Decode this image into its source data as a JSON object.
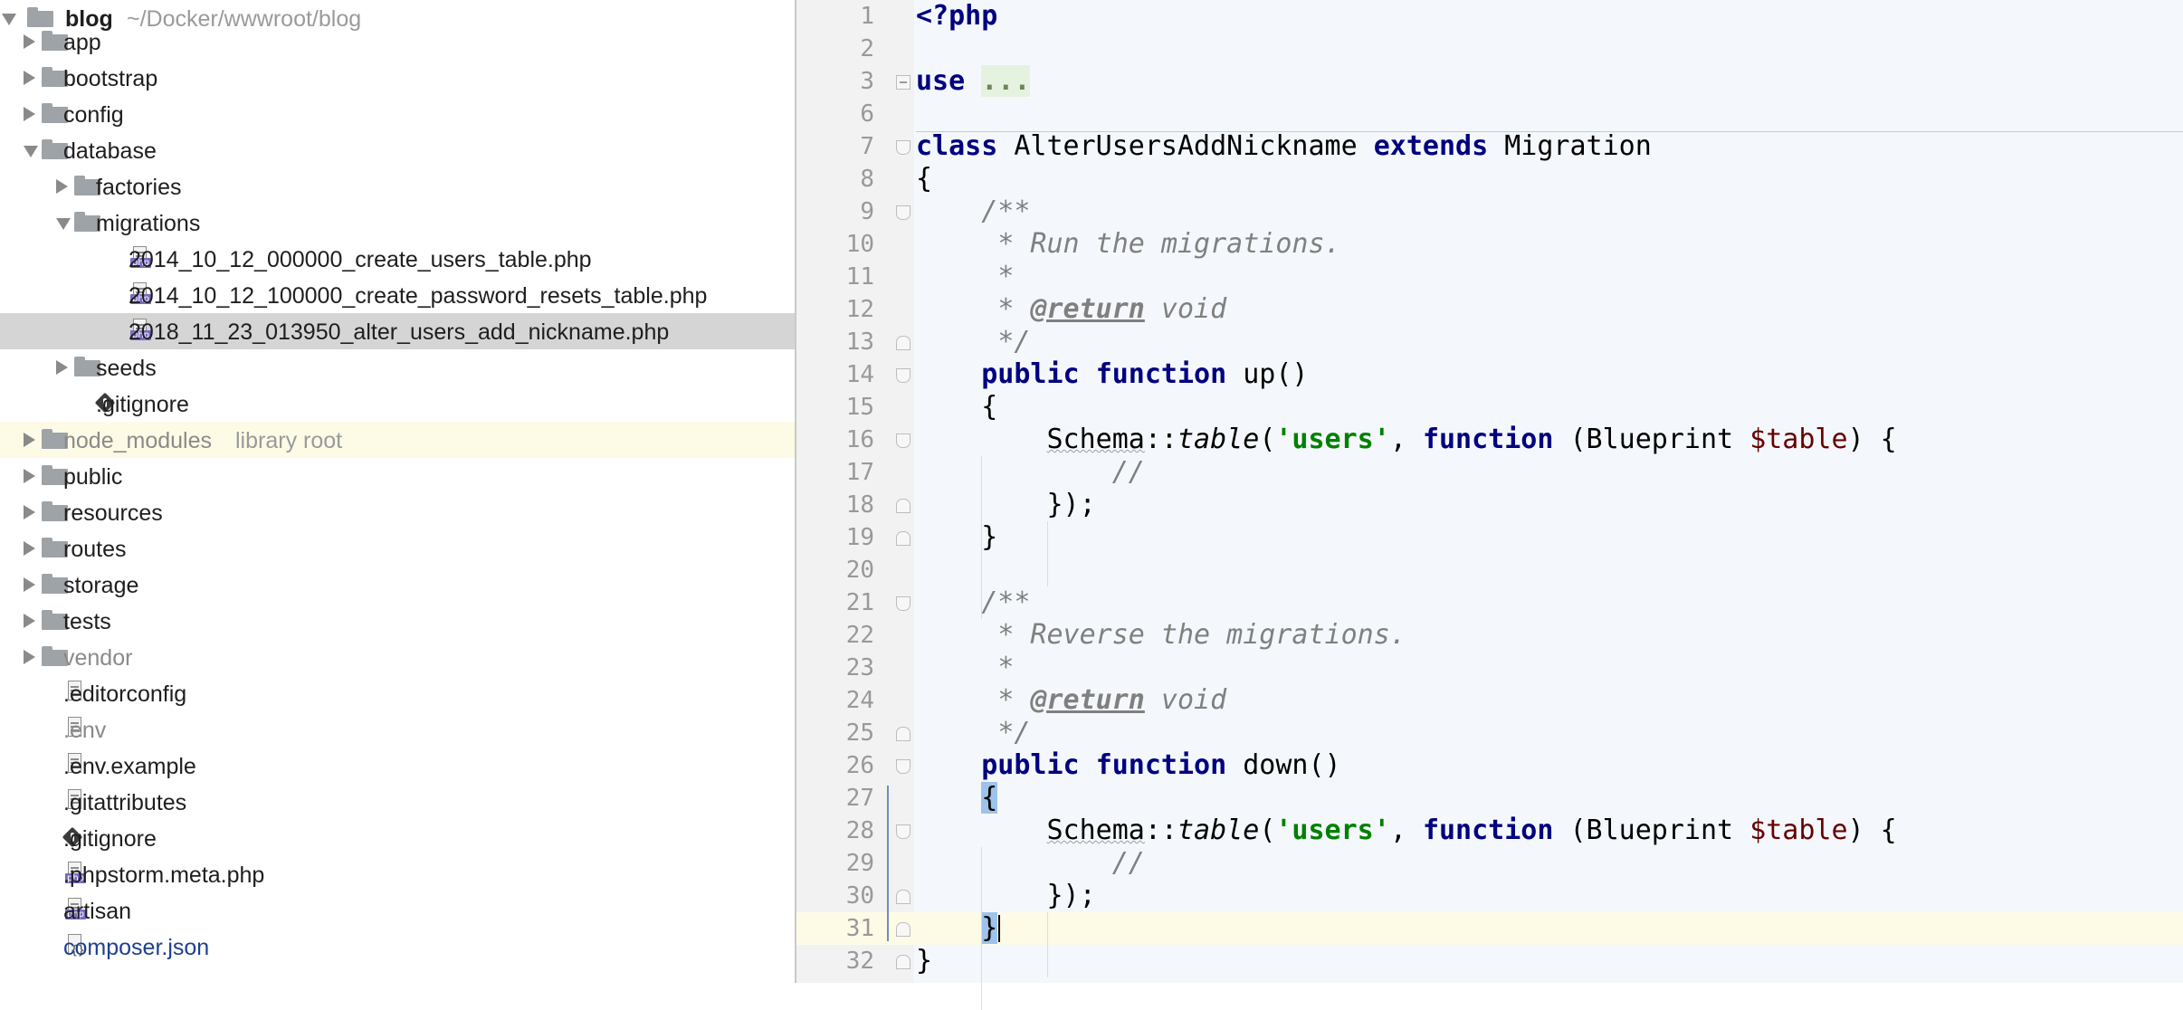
{
  "project_tree": {
    "root": {
      "name": "blog",
      "path": "~/Docker/wwwroot/blog"
    },
    "items": [
      {
        "label": "app",
        "kind": "folder",
        "depth": 1,
        "state": "collapsed"
      },
      {
        "label": "bootstrap",
        "kind": "folder",
        "depth": 1,
        "state": "collapsed"
      },
      {
        "label": "config",
        "kind": "folder",
        "depth": 1,
        "state": "collapsed"
      },
      {
        "label": "database",
        "kind": "folder",
        "depth": 1,
        "state": "expanded"
      },
      {
        "label": "factories",
        "kind": "folder",
        "depth": 2,
        "state": "collapsed"
      },
      {
        "label": "migrations",
        "kind": "folder",
        "depth": 2,
        "state": "expanded"
      },
      {
        "label": "2014_10_12_000000_create_users_table.php",
        "kind": "php",
        "depth": 3
      },
      {
        "label": "2014_10_12_100000_create_password_resets_table.php",
        "kind": "php",
        "depth": 3
      },
      {
        "label": "2018_11_23_013950_alter_users_add_nickname.php",
        "kind": "php",
        "depth": 3,
        "selected": true
      },
      {
        "label": "seeds",
        "kind": "folder",
        "depth": 2,
        "state": "collapsed"
      },
      {
        "label": ".gitignore",
        "kind": "git",
        "depth": 2
      },
      {
        "label": "node_modules",
        "kind": "folder",
        "depth": 1,
        "state": "collapsed",
        "excluded": true,
        "hint": "library root"
      },
      {
        "label": "public",
        "kind": "folder",
        "depth": 1,
        "state": "collapsed"
      },
      {
        "label": "resources",
        "kind": "folder",
        "depth": 1,
        "state": "collapsed"
      },
      {
        "label": "routes",
        "kind": "folder",
        "depth": 1,
        "state": "collapsed"
      },
      {
        "label": "storage",
        "kind": "folder",
        "depth": 1,
        "state": "collapsed"
      },
      {
        "label": "tests",
        "kind": "folder",
        "depth": 1,
        "state": "collapsed"
      },
      {
        "label": "vendor",
        "kind": "folder",
        "depth": 1,
        "state": "collapsed",
        "dim": true
      },
      {
        "label": ".editorconfig",
        "kind": "text",
        "depth": 1
      },
      {
        "label": ".env",
        "kind": "text",
        "depth": 1,
        "dim": true
      },
      {
        "label": ".env.example",
        "kind": "text",
        "depth": 1
      },
      {
        "label": ".gitattributes",
        "kind": "text",
        "depth": 1
      },
      {
        "label": ".gitignore",
        "kind": "git",
        "depth": 1
      },
      {
        "label": ".phpstorm.meta.php",
        "kind": "php",
        "depth": 1
      },
      {
        "label": "artisan",
        "kind": "php",
        "depth": 1
      },
      {
        "label": "composer.json",
        "kind": "json",
        "depth": 1,
        "link": true
      }
    ]
  },
  "editor": {
    "current_line": "31",
    "lines": [
      {
        "n": "1",
        "tokens": [
          {
            "t": "<?php",
            "c": "kw"
          }
        ]
      },
      {
        "n": "2",
        "tokens": []
      },
      {
        "n": "3",
        "fold": "collapsed",
        "tokens": [
          {
            "t": "use",
            "c": "kw"
          },
          {
            "t": " "
          },
          {
            "t": "...",
            "c": "fold"
          }
        ]
      },
      {
        "n": "6",
        "tokens": []
      },
      {
        "n": "7",
        "fold": "open",
        "sep": true,
        "tokens": [
          {
            "t": "class",
            "c": "kw"
          },
          {
            "t": " AlterUsersAddNickname "
          },
          {
            "t": "extends",
            "c": "kw"
          },
          {
            "t": " Migration"
          }
        ]
      },
      {
        "n": "8",
        "tokens": [
          {
            "t": "{"
          }
        ]
      },
      {
        "n": "9",
        "fold": "open",
        "tokens": [
          {
            "t": "    "
          },
          {
            "t": "/**",
            "c": "cmt"
          }
        ]
      },
      {
        "n": "10",
        "tokens": [
          {
            "t": "     "
          },
          {
            "t": "* Run the migrations.",
            "c": "cmt"
          }
        ]
      },
      {
        "n": "11",
        "tokens": [
          {
            "t": "     "
          },
          {
            "t": "*",
            "c": "cmt"
          }
        ]
      },
      {
        "n": "12",
        "tokens": [
          {
            "t": "     "
          },
          {
            "t": "* ",
            "c": "cmt"
          },
          {
            "t": "@return",
            "c": "tag"
          },
          {
            "t": " void",
            "c": "cmt"
          }
        ]
      },
      {
        "n": "13",
        "fold": "close",
        "tokens": [
          {
            "t": "     "
          },
          {
            "t": "*/",
            "c": "cmt"
          }
        ]
      },
      {
        "n": "14",
        "fold": "open",
        "tokens": [
          {
            "t": "    "
          },
          {
            "t": "public",
            "c": "kw"
          },
          {
            "t": " "
          },
          {
            "t": "function",
            "c": "kw"
          },
          {
            "t": " up()"
          }
        ]
      },
      {
        "n": "15",
        "tokens": [
          {
            "t": "    {"
          }
        ]
      },
      {
        "n": "16",
        "fold": "open",
        "tokens": [
          {
            "t": "        "
          },
          {
            "t": "Schema",
            "c": "class"
          },
          {
            "t": "::"
          },
          {
            "t": "table",
            "c": "static"
          },
          {
            "t": "("
          },
          {
            "t": "'users'",
            "c": "str"
          },
          {
            "t": ", "
          },
          {
            "t": "function",
            "c": "kw"
          },
          {
            "t": " (Blueprint "
          },
          {
            "t": "$table",
            "c": "var"
          },
          {
            "t": ") {"
          }
        ]
      },
      {
        "n": "17",
        "tokens": [
          {
            "t": "            "
          },
          {
            "t": "//",
            "c": "cmt"
          }
        ]
      },
      {
        "n": "18",
        "fold": "close",
        "tokens": [
          {
            "t": "        });"
          }
        ]
      },
      {
        "n": "19",
        "fold": "close",
        "tokens": [
          {
            "t": "    }"
          }
        ]
      },
      {
        "n": "20",
        "tokens": []
      },
      {
        "n": "21",
        "fold": "open",
        "tokens": [
          {
            "t": "    "
          },
          {
            "t": "/**",
            "c": "cmt"
          }
        ]
      },
      {
        "n": "22",
        "tokens": [
          {
            "t": "     "
          },
          {
            "t": "* Reverse the migrations.",
            "c": "cmt"
          }
        ]
      },
      {
        "n": "23",
        "tokens": [
          {
            "t": "     "
          },
          {
            "t": "*",
            "c": "cmt"
          }
        ]
      },
      {
        "n": "24",
        "tokens": [
          {
            "t": "     "
          },
          {
            "t": "* ",
            "c": "cmt"
          },
          {
            "t": "@return",
            "c": "tag"
          },
          {
            "t": " void",
            "c": "cmt"
          }
        ]
      },
      {
        "n": "25",
        "fold": "close",
        "tokens": [
          {
            "t": "     "
          },
          {
            "t": "*/",
            "c": "cmt"
          }
        ]
      },
      {
        "n": "26",
        "fold": "open",
        "tokens": [
          {
            "t": "    "
          },
          {
            "t": "public",
            "c": "kw"
          },
          {
            "t": " "
          },
          {
            "t": "function",
            "c": "kw"
          },
          {
            "t": " down()"
          }
        ]
      },
      {
        "n": "27",
        "tokens": [
          {
            "t": "    "
          },
          {
            "t": "{",
            "c": "brace"
          }
        ]
      },
      {
        "n": "28",
        "fold": "open",
        "tokens": [
          {
            "t": "        "
          },
          {
            "t": "Schema",
            "c": "class"
          },
          {
            "t": "::"
          },
          {
            "t": "table",
            "c": "static"
          },
          {
            "t": "("
          },
          {
            "t": "'users'",
            "c": "str"
          },
          {
            "t": ", "
          },
          {
            "t": "function",
            "c": "kw"
          },
          {
            "t": " (Blueprint "
          },
          {
            "t": "$table",
            "c": "var"
          },
          {
            "t": ") {"
          }
        ]
      },
      {
        "n": "29",
        "tokens": [
          {
            "t": "            "
          },
          {
            "t": "//",
            "c": "cmt"
          }
        ]
      },
      {
        "n": "30",
        "fold": "close",
        "tokens": [
          {
            "t": "        });"
          }
        ]
      },
      {
        "n": "31",
        "fold": "close",
        "current": true,
        "tokens": [
          {
            "t": "    "
          },
          {
            "t": "}",
            "c": "brace"
          }
        ]
      },
      {
        "n": "32",
        "fold": "close",
        "tokens": [
          {
            "t": "}"
          }
        ]
      }
    ]
  },
  "colors": {
    "keyword": "#000080",
    "string": "#008000",
    "comment": "#808080",
    "variable": "#660000",
    "selection": "#d5d5d5",
    "current_line": "#fdfbe6",
    "brace_match": "#9dc3ea"
  }
}
